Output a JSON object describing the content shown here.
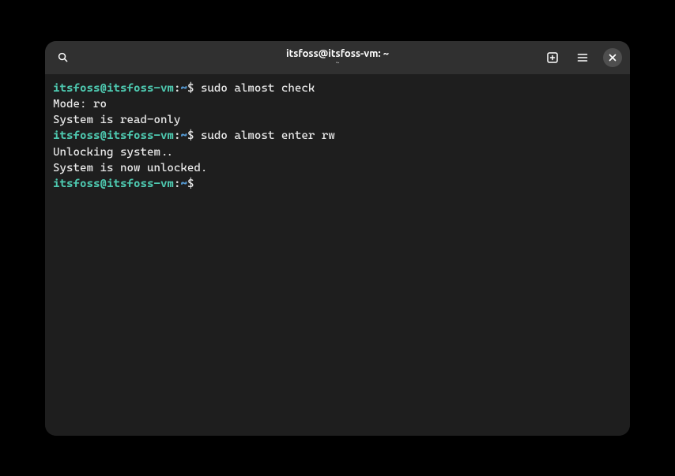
{
  "window": {
    "title": "itsfoss@itsfoss-vm: ~",
    "subtitle": "~"
  },
  "prompt": {
    "user_host": "itsfoss@itsfoss-vm",
    "colon": ":",
    "path": "~",
    "symbol": "$ "
  },
  "lines": {
    "cmd1": "sudo almost check",
    "out1": "Mode: ro",
    "out2": "System is read-only",
    "cmd2": "sudo almost enter rw",
    "out3": "Unlocking system..",
    "out4": "System is now unlocked.",
    "cmd3": ""
  },
  "colors": {
    "user_host": "#4ec9b0",
    "path": "#569cd6",
    "text": "#e8e8e8",
    "bg": "#1e1e1e",
    "titlebar": "#303030"
  }
}
